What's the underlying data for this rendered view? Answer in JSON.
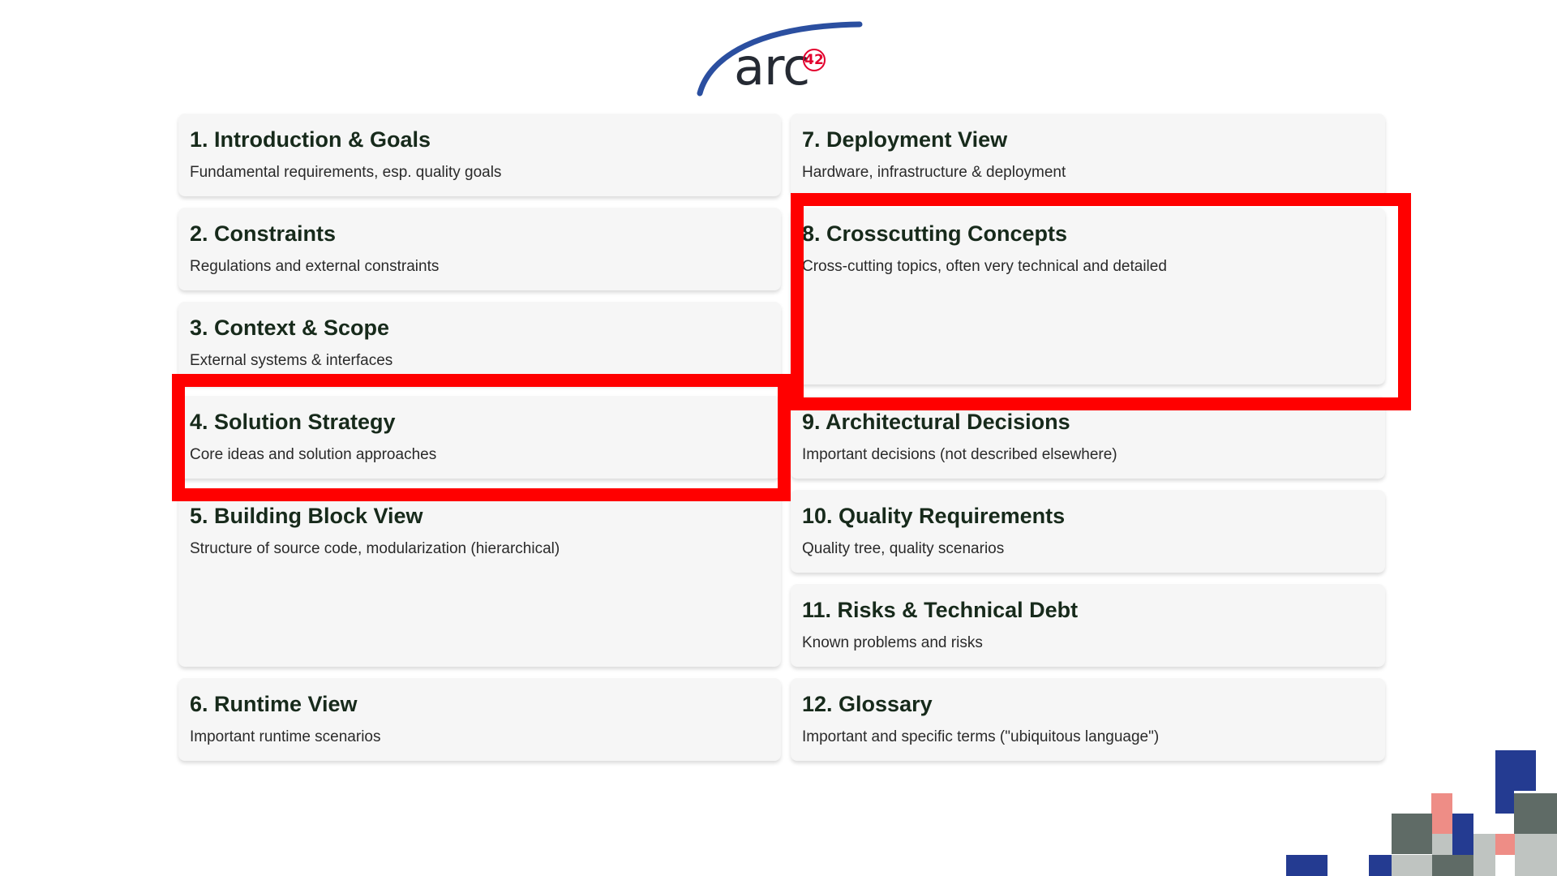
{
  "logo": {
    "text": "arc",
    "badge": "42",
    "arc_color": "#2b4fa0",
    "badge_color": "#e3002d"
  },
  "sections": [
    {
      "title": "1. Introduction & Goals",
      "desc": "Fundamental requirements, esp. quality goals"
    },
    {
      "title": "2. Constraints",
      "desc": "Regulations and external constraints"
    },
    {
      "title": "3. Context & Scope",
      "desc": "External systems & interfaces"
    },
    {
      "title": "4. Solution Strategy",
      "desc": "Core ideas and solution approaches"
    },
    {
      "title": "5. Building Block View",
      "desc": "Structure of source code, modularization (hierarchical)"
    },
    {
      "title": "6. Runtime View",
      "desc": "Important runtime scenarios"
    },
    {
      "title": "7. Deployment View",
      "desc": "Hardware, infrastructure & deployment"
    },
    {
      "title": "8. Crosscutting Concepts",
      "desc": "Cross-cutting topics, often very technical and detailed"
    },
    {
      "title": "9. Architectural Decisions",
      "desc": "Important decisions (not described elsewhere)"
    },
    {
      "title": "10. Quality Requirements",
      "desc": "Quality tree, quality scenarios"
    },
    {
      "title": "11. Risks & Technical Debt",
      "desc": "Known problems and risks"
    },
    {
      "title": "12. Glossary",
      "desc": "Important and specific terms (\"ubiquitous language\")"
    }
  ],
  "highlight_color": "#ff0000",
  "decoration_colors": {
    "blue": "#243b91",
    "gray": "#5f6b66",
    "pink": "#ee8d86",
    "light": "#bfc4c1"
  }
}
